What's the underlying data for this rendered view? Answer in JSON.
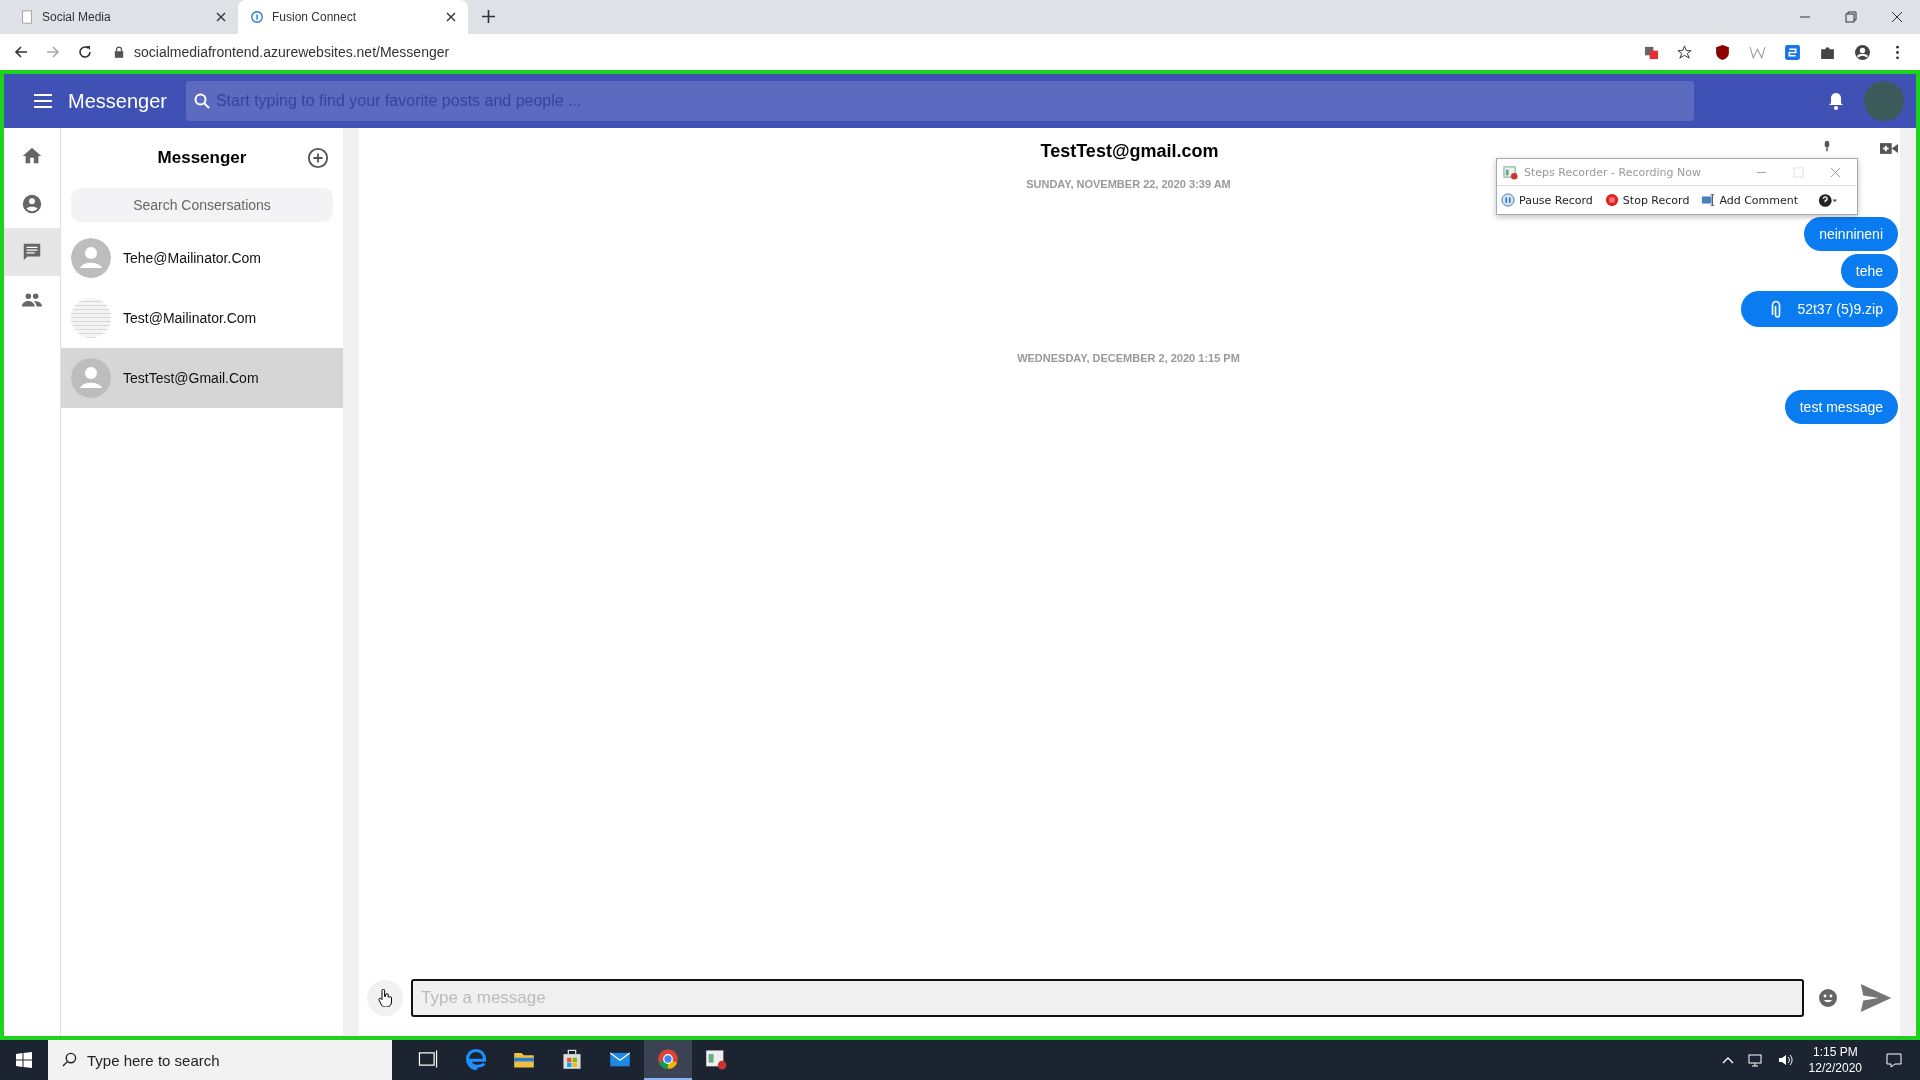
{
  "browser": {
    "tabs": [
      {
        "title": "Social Media",
        "selected": false
      },
      {
        "title": "Fusion Connect",
        "selected": true
      }
    ],
    "url": "socialmediafrontend.azurewebsites.net/Messenger"
  },
  "header": {
    "title": "Messenger",
    "search": {
      "placeholder": "Start typing to find your favorite posts and people ..."
    }
  },
  "nav": [
    {
      "kind": "home",
      "selected": false
    },
    {
      "kind": "profile",
      "selected": false
    },
    {
      "kind": "chat",
      "selected": true
    },
    {
      "kind": "people",
      "selected": false
    }
  ],
  "conversations": {
    "title": "Messenger",
    "search": {
      "placeholder": "Search Consersations"
    },
    "items": [
      {
        "name": "Tehe@Mailinator.Com",
        "kind": "default",
        "selected": false
      },
      {
        "name": "Test@Mailinator.Com",
        "kind": "image",
        "selected": false
      },
      {
        "name": "TestTest@Gmail.Com",
        "kind": "default",
        "selected": true
      }
    ]
  },
  "chat": {
    "title": "TestTest@gmail.com",
    "groups": [
      {
        "date": "SUNDAY, NOVEMBER 22, 2020 3:39 AM",
        "messages": [
          {
            "kind": "text",
            "text": "neinnineni"
          },
          {
            "kind": "text",
            "text": "tehe"
          },
          {
            "kind": "file",
            "text": "52t37 (5)9.zip"
          }
        ]
      },
      {
        "date": "WEDNESDAY, DECEMBER 2, 2020 1:15 PM",
        "messages": [
          {
            "kind": "text",
            "text": "test message"
          }
        ]
      }
    ],
    "composer": {
      "placeholder": "Type a message"
    }
  },
  "steps_recorder": {
    "title": "Steps Recorder - Recording Now",
    "buttons": [
      {
        "kind": "pause",
        "label": "Pause Record"
      },
      {
        "kind": "stop",
        "label": "Stop Record"
      },
      {
        "kind": "comment",
        "label": "Add Comment"
      }
    ]
  },
  "taskbar": {
    "search": {
      "placeholder": "Type here to search"
    },
    "apps": [
      {
        "kind": "taskview",
        "selected": false
      },
      {
        "kind": "edge",
        "selected": false
      },
      {
        "kind": "files",
        "selected": false
      },
      {
        "kind": "store",
        "selected": false
      },
      {
        "kind": "mail",
        "selected": false
      },
      {
        "kind": "chrome",
        "selected": true
      },
      {
        "kind": "recorder",
        "selected": false
      }
    ],
    "time": "1:15 PM",
    "date": "12/2/2020"
  }
}
